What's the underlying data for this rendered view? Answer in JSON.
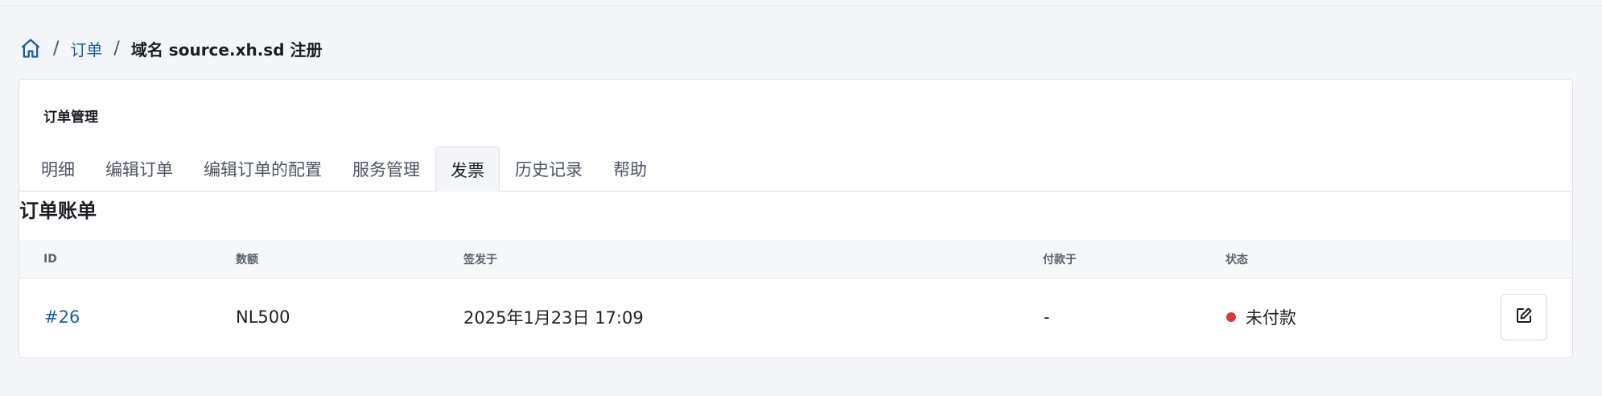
{
  "breadcrumb": {
    "home_icon": "home-icon",
    "separator": "/",
    "orders_label": "订单",
    "current_label": "域名 source.xh.sd 注册"
  },
  "card": {
    "title": "订单管理",
    "tabs": [
      {
        "label": "明细"
      },
      {
        "label": "编辑订单"
      },
      {
        "label": "编辑订单的配置"
      },
      {
        "label": "服务管理"
      },
      {
        "label": "发票",
        "active": true
      },
      {
        "label": "历史记录"
      },
      {
        "label": "帮助"
      }
    ]
  },
  "invoices": {
    "heading": "订单账单",
    "columns": {
      "id": "ID",
      "amount": "数额",
      "issued": "签发于",
      "paid": "付款于",
      "status": "状态"
    },
    "rows": [
      {
        "id": "#26",
        "amount": "NL500",
        "issued": "2025年1月23日 17:09",
        "paid": "-",
        "status": "未付款",
        "status_color": "#d43c3c",
        "action_icon": "edit-icon"
      }
    ]
  },
  "colors": {
    "link": "#1a5ea8",
    "background": "#f4f5f8",
    "status_unpaid": "#d43c3c"
  }
}
